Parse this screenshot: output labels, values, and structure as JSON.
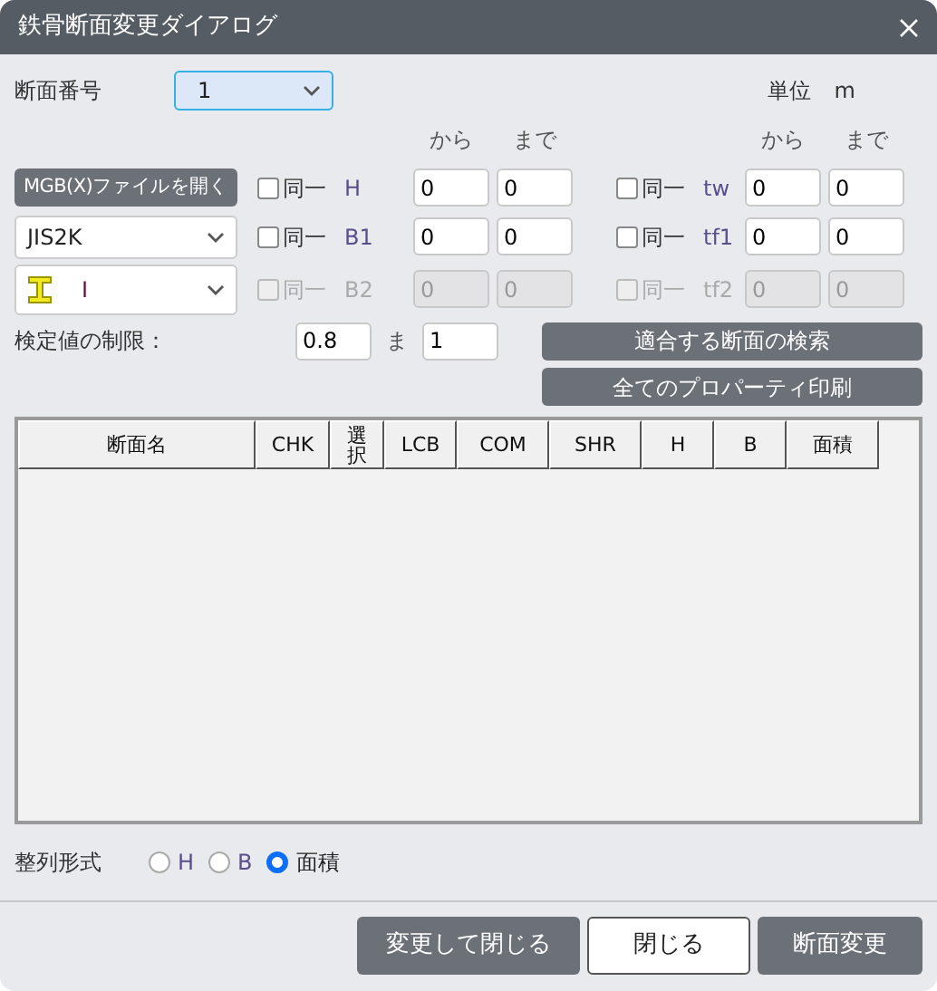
{
  "window": {
    "title": "鉄骨断面変更ダイアログ"
  },
  "section_number": {
    "label": "断面番号",
    "value": "1"
  },
  "unit": {
    "label": "単位",
    "value": "m"
  },
  "range_headers": [
    "から",
    "まで",
    "から",
    "まで"
  ],
  "open_button": "MGB(X)ファイルを開く",
  "standard_select": {
    "value": "JIS2K"
  },
  "shape_select": {
    "value": "I"
  },
  "params": [
    {
      "same_label": "同一",
      "name": "H",
      "checked": false,
      "disabled": false,
      "from": "0",
      "to": "0"
    },
    {
      "same_label": "同一",
      "name": "tw",
      "checked": false,
      "disabled": false,
      "from": "0",
      "to": "0"
    },
    {
      "same_label": "同一",
      "name": "B1",
      "checked": false,
      "disabled": false,
      "from": "0",
      "to": "0"
    },
    {
      "same_label": "同一",
      "name": "tf1",
      "checked": false,
      "disabled": false,
      "from": "0",
      "to": "0"
    },
    {
      "same_label": "同一",
      "name": "B2",
      "checked": false,
      "disabled": true,
      "from": "0",
      "to": "0"
    },
    {
      "same_label": "同一",
      "name": "tf2",
      "checked": false,
      "disabled": true,
      "from": "0",
      "to": "0"
    }
  ],
  "limit": {
    "label": "検定値の制限：",
    "from": "0.8",
    "to_label": "ま",
    "to": "1"
  },
  "search_button": "適合する断面の検索",
  "print_button": "全てのプロパーティ印刷",
  "table": {
    "columns": [
      "断面名",
      "CHK",
      "選択",
      "LCB",
      "COM",
      "SHR",
      "H",
      "B",
      "面積"
    ]
  },
  "sort": {
    "label": "整列形式",
    "options": [
      {
        "label": "H",
        "selected": false
      },
      {
        "label": "B",
        "selected": false
      },
      {
        "label": "面積",
        "selected": true
      }
    ]
  },
  "buttons": [
    {
      "label": "変更して閉じる",
      "kind": "filled"
    },
    {
      "label": "閉じる",
      "kind": "outline"
    },
    {
      "label": "断面変更",
      "kind": "filled"
    }
  ]
}
